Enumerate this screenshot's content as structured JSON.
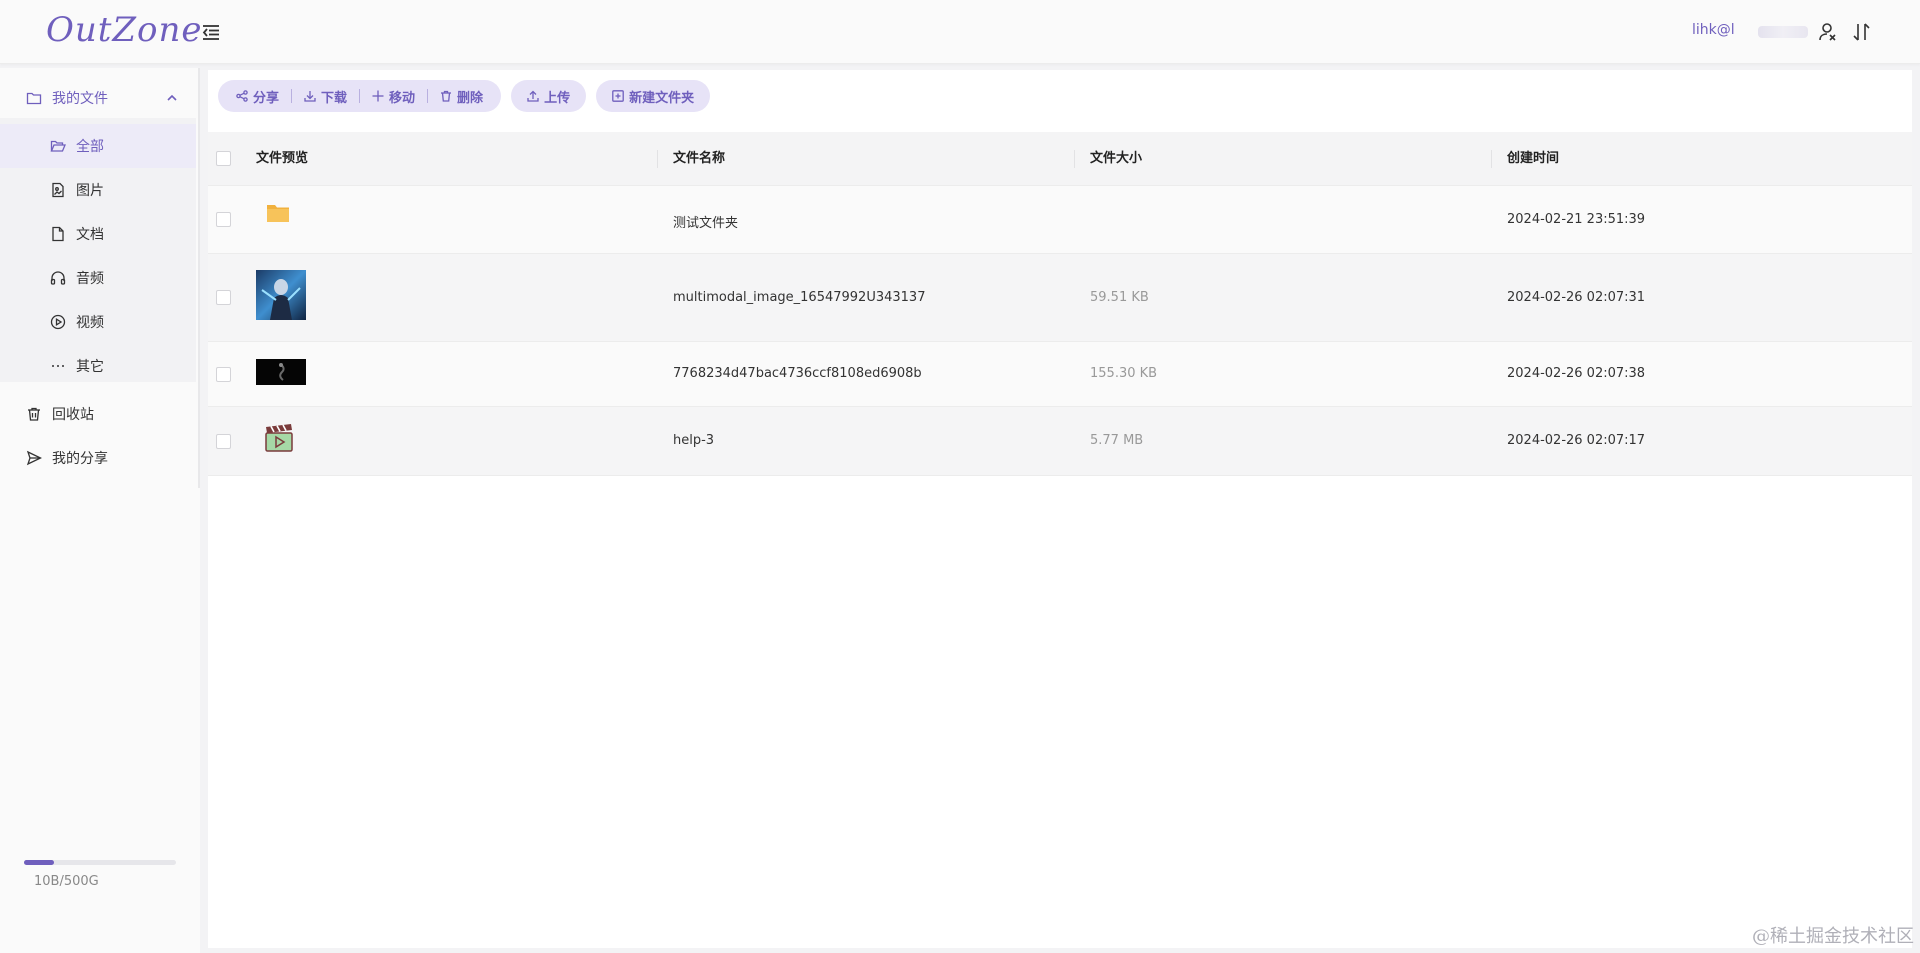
{
  "header": {
    "logo": "OutZone",
    "user_email": "lihk@l"
  },
  "sidebar": {
    "my_files": "我的文件",
    "items": [
      {
        "label": "全部",
        "icon": "folder-open-icon"
      },
      {
        "label": "图片",
        "icon": "image-file-icon"
      },
      {
        "label": "文档",
        "icon": "document-icon"
      },
      {
        "label": "音频",
        "icon": "headphones-icon"
      },
      {
        "label": "视频",
        "icon": "play-circle-icon"
      },
      {
        "label": "其它",
        "icon": "ellipsis-icon"
      }
    ],
    "recycle": "回收站",
    "my_share": "我的分享",
    "storage_text": "10B/500G",
    "storage_fraction": 0.2
  },
  "toolbar": {
    "share": "分享",
    "download": "下载",
    "move": "移动",
    "delete": "删除",
    "upload": "上传",
    "new_folder": "新建文件夹"
  },
  "table": {
    "headers": [
      "文件预览",
      "文件名称",
      "文件大小",
      "创建时间"
    ],
    "rows": [
      {
        "name": "测试文件夹",
        "size": "",
        "created": "2024-02-21 23:51:39",
        "type": "folder"
      },
      {
        "name": "multimodal_image_16547992U343137",
        "size": "59.51 KB",
        "created": "2024-02-26 02:07:31",
        "type": "image"
      },
      {
        "name": "7768234d47bac4736ccf8108ed6908b",
        "size": "155.30 KB",
        "created": "2024-02-26 02:07:38",
        "type": "image-dark"
      },
      {
        "name": "help-3",
        "size": "5.77 MB",
        "created": "2024-02-26 02:07:17",
        "type": "video"
      }
    ]
  },
  "colors": {
    "accent": "#6f5fbd",
    "accent_light": "#e7e3f7",
    "folder": "#f7c35a"
  },
  "watermark": "@稀土掘金技术社区"
}
